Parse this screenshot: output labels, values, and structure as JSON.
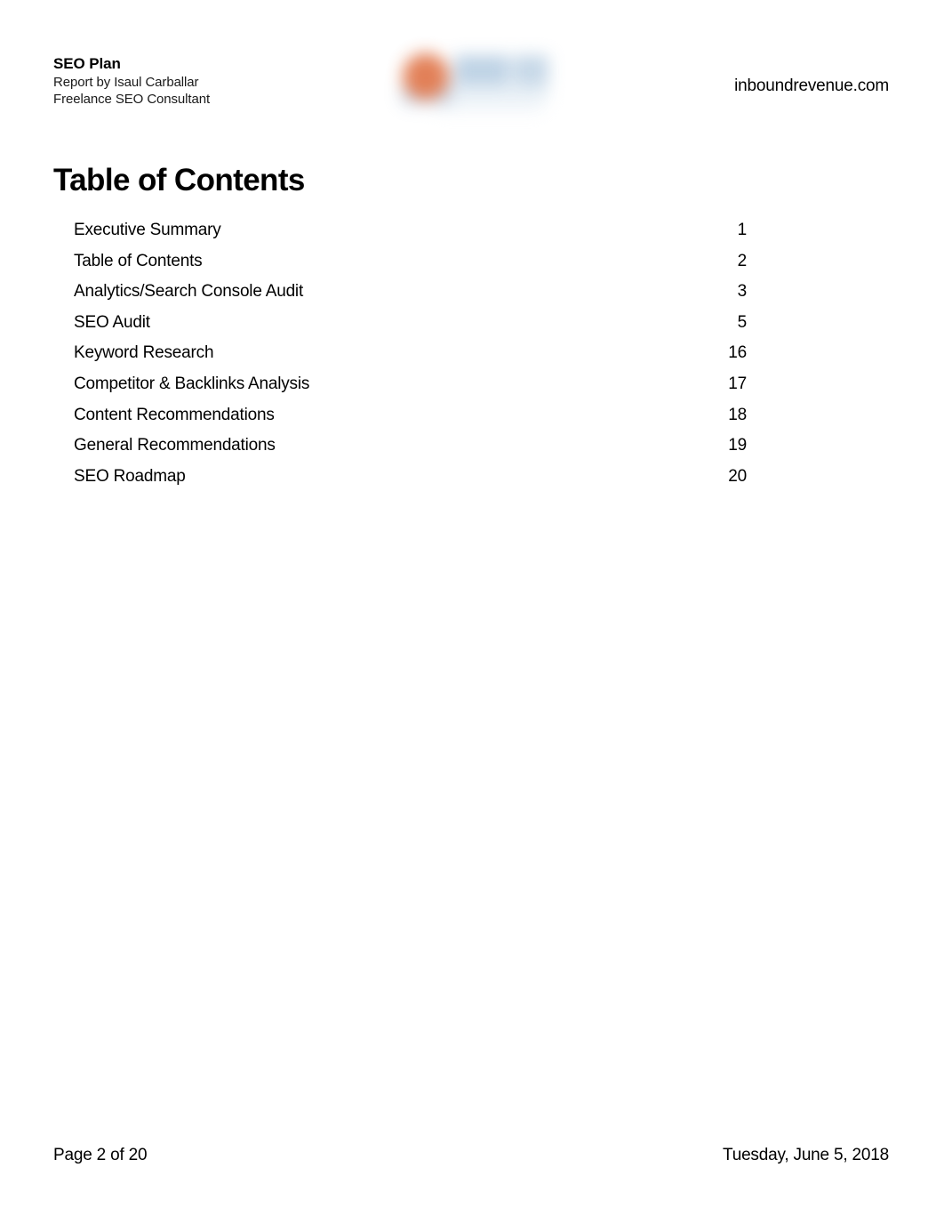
{
  "document": {
    "header": {
      "title": "SEO Plan",
      "subtitle_line_1": "Report by Isaul Carballar",
      "subtitle_line_2": "Freelance SEO Consultant",
      "website": "inboundrevenue.com",
      "logo": {
        "name": "company-logo-blurred",
        "mark_color": "#e0764a",
        "wordmark_color": "#b9cfe3"
      }
    },
    "page_heading": "Table of Contents",
    "toc": {
      "entries": [
        {
          "label": "Executive Summary",
          "page": "1"
        },
        {
          "label": "Table of Contents",
          "page": "2"
        },
        {
          "label": "Analytics/Search Console Audit",
          "page": "3"
        },
        {
          "label": "SEO Audit",
          "page": "5"
        },
        {
          "label": "Keyword Research",
          "page": "16"
        },
        {
          "label": "Competitor & Backlinks Analysis",
          "page": "17"
        },
        {
          "label": "Content Recommendations",
          "page": "18"
        },
        {
          "label": "General Recommendations",
          "page": "19"
        },
        {
          "label": "SEO Roadmap",
          "page": "20"
        }
      ]
    },
    "footer": {
      "page_indicator": "Page 2 of 20",
      "date": "Tuesday, June 5, 2018"
    }
  }
}
